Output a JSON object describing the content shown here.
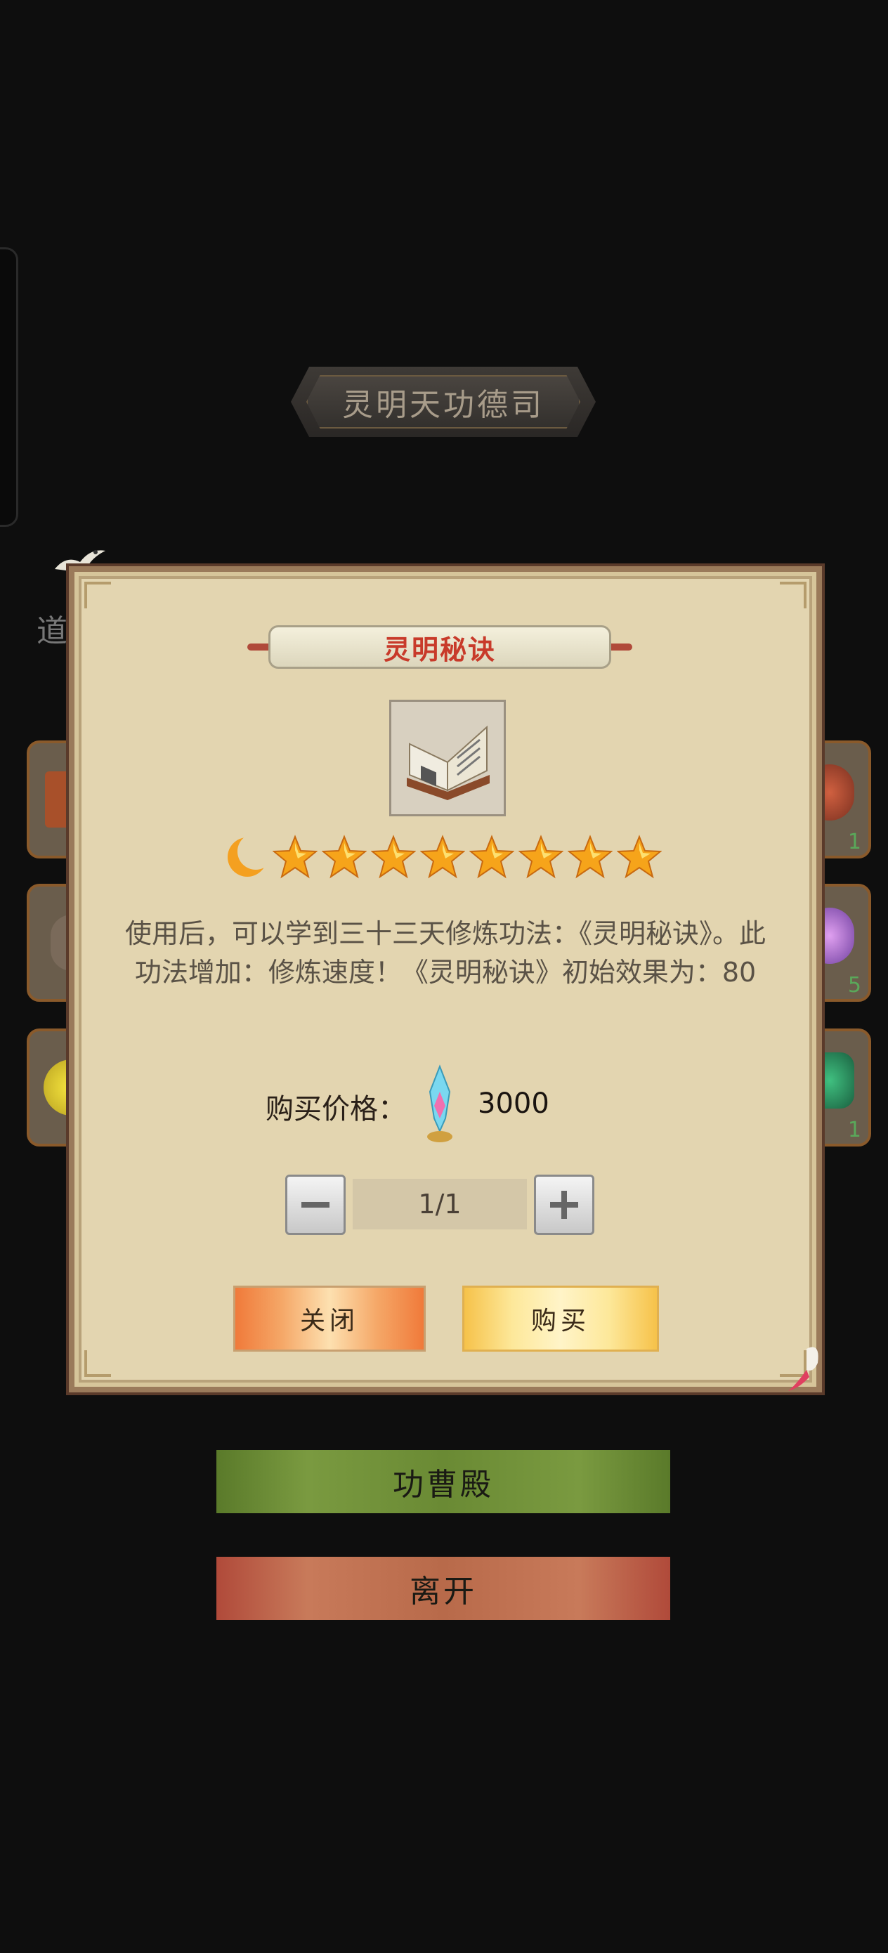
{
  "background": {
    "title": "灵明天功德司",
    "side_label": "道",
    "slot_counts": [
      "1",
      "5",
      "1"
    ],
    "menu": {
      "gongcao": "功曹殿",
      "leave": "离开"
    }
  },
  "dialog": {
    "item_name": "灵明秘诀",
    "item_icon": "book-icon",
    "rating": {
      "moons": 1,
      "stars": 8
    },
    "description": "使用后，可以学到三十三天修炼功法：《灵明秘诀》。此功法增加：修炼速度！《灵明秘诀》初始效果为：80",
    "price_label": "购买价格：",
    "currency_icon": "gem-icon",
    "price": "3000",
    "quantity": "1/1",
    "buttons": {
      "close": "关闭",
      "buy": "购买"
    }
  },
  "colors": {
    "item_name": "#c83a2a",
    "close_button": "#f07a3a",
    "buy_button": "#f6c24a",
    "gongcao_button": "#6a8a34",
    "leave_button": "#b86a4a"
  }
}
